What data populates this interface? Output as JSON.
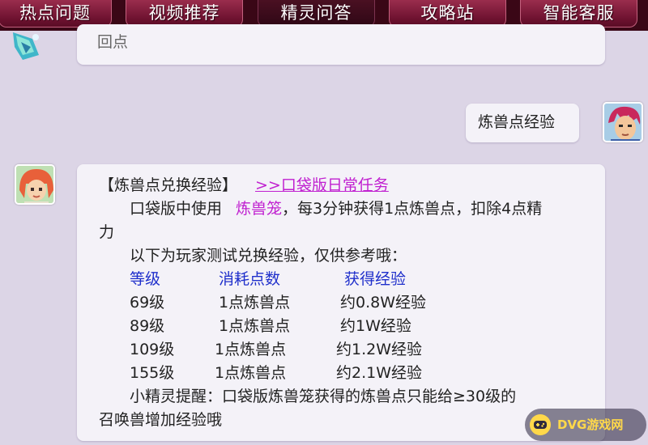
{
  "tabs": [
    {
      "label": "热点问题"
    },
    {
      "label": "视频推荐"
    },
    {
      "label": "精灵问答"
    },
    {
      "label": "攻略站"
    },
    {
      "label": "智能客服"
    }
  ],
  "prev_message": {
    "text": "回点"
  },
  "user_message": {
    "text": "炼兽点经验"
  },
  "reply": {
    "title": "【炼兽点兑换经验】",
    "link": ">>口袋版日常任务",
    "line1_a": "口袋版中使用",
    "line1_hl": "炼兽笼",
    "line1_b": "，每3分钟获得1点炼兽点，扣除4点精",
    "line2": "力",
    "intro": "以下为玩家测试兑换经验，仅供参考哦：",
    "headers": [
      "等级",
      "消耗点数",
      "获得经验"
    ],
    "rows": [
      [
        "69级",
        "1点炼兽点",
        "约0.8W经验"
      ],
      [
        "89级",
        "1点炼兽点",
        "约1W经验"
      ],
      [
        "109级",
        "1点炼兽点",
        "约1.2W经验"
      ],
      [
        "155级",
        "1点炼兽点",
        "约2.1W经验"
      ]
    ],
    "tip1": "小精灵提醒：口袋版炼兽笼获得的炼兽点只能给≥30级的",
    "tip2": "召唤兽增加经验哦"
  },
  "watermark": {
    "text": "DVG游戏网"
  },
  "colors": {
    "link": "#c020d0",
    "header": "#1f2fcb",
    "topbar": "#3a0716",
    "tab": "#7a1636"
  },
  "icons": {
    "sprite": "fairy-sprite-icon",
    "user_avatar": "red-hair-warrior-avatar",
    "bot_avatar": "red-hair-girl-avatar"
  }
}
